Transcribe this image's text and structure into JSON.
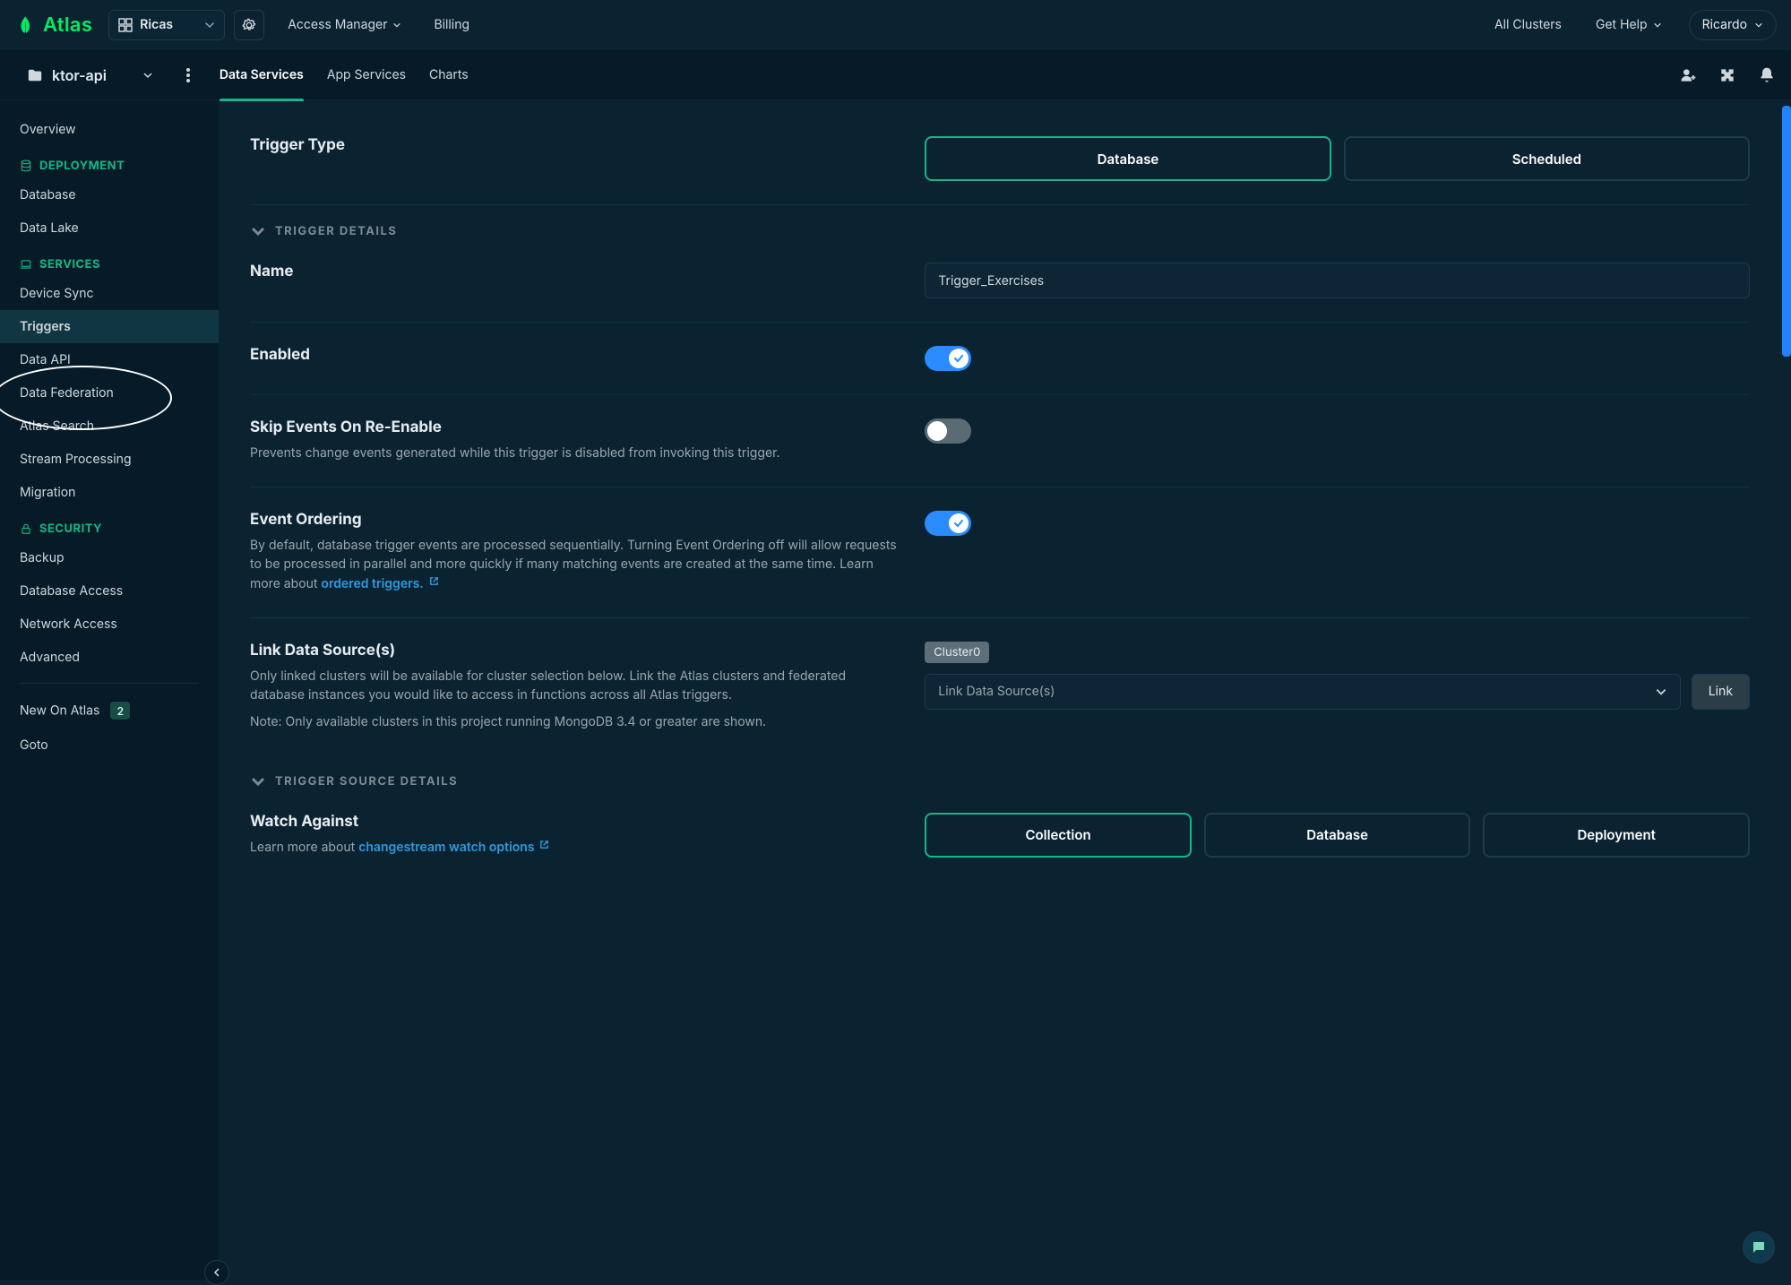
{
  "top": {
    "brand": "Atlas",
    "project": "Ricas",
    "access_manager": "Access Manager",
    "billing": "Billing",
    "all_clusters": "All Clusters",
    "get_help": "Get Help",
    "user": "Ricardo"
  },
  "sec": {
    "folder": "ktor-api",
    "tabs": [
      "Data Services",
      "App Services",
      "Charts"
    ],
    "active_tab_index": 0
  },
  "sidebar": {
    "overview": "Overview",
    "deployment_head": "DEPLOYMENT",
    "deployment": [
      "Database",
      "Data Lake"
    ],
    "services_head": "SERVICES",
    "services": [
      "Device Sync",
      "Triggers",
      "Data API",
      "Data Federation",
      "Atlas Search",
      "Stream Processing",
      "Migration"
    ],
    "security_head": "SECURITY",
    "security": [
      "Backup",
      "Database Access",
      "Network Access",
      "Advanced"
    ],
    "new_on_atlas": "New On Atlas",
    "new_on_atlas_count": "2",
    "goto": "Goto"
  },
  "form": {
    "trigger_type_label": "Trigger Type",
    "trigger_type_options": [
      "Database",
      "Scheduled"
    ],
    "trigger_type_selected_index": 0,
    "section_details": "TRIGGER DETAILS",
    "name_label": "Name",
    "name_value": "Trigger_Exercises",
    "enabled_label": "Enabled",
    "enabled_value": true,
    "skip_label": "Skip Events On Re-Enable",
    "skip_desc": "Prevents change events generated while this trigger is disabled from invoking this trigger.",
    "skip_value": false,
    "order_label": "Event Ordering",
    "order_desc": "By default, database trigger events are processed sequentially. Turning Event Ordering off will allow requests to be processed in parallel and more quickly if many matching events are created at the same time. Learn more about ",
    "order_link": "ordered triggers.",
    "order_value": true,
    "link_label": "Link Data Source(s)",
    "link_desc1": "Only linked clusters will be available for cluster selection below. Link the Atlas clusters and federated database instances you would like to access in functions across all Atlas triggers.",
    "link_desc2": "Note: Only available clusters in this project running MongoDB 3.4 or greater are shown.",
    "link_chip": "Cluster0",
    "link_placeholder": "Link Data Source(s)",
    "link_button": "Link",
    "section_source": "TRIGGER SOURCE DETAILS",
    "watch_label": "Watch Against",
    "watch_desc": "Learn more about ",
    "watch_link": "changestream watch options",
    "watch_options": [
      "Collection",
      "Database",
      "Deployment"
    ],
    "watch_selected_index": 0
  }
}
